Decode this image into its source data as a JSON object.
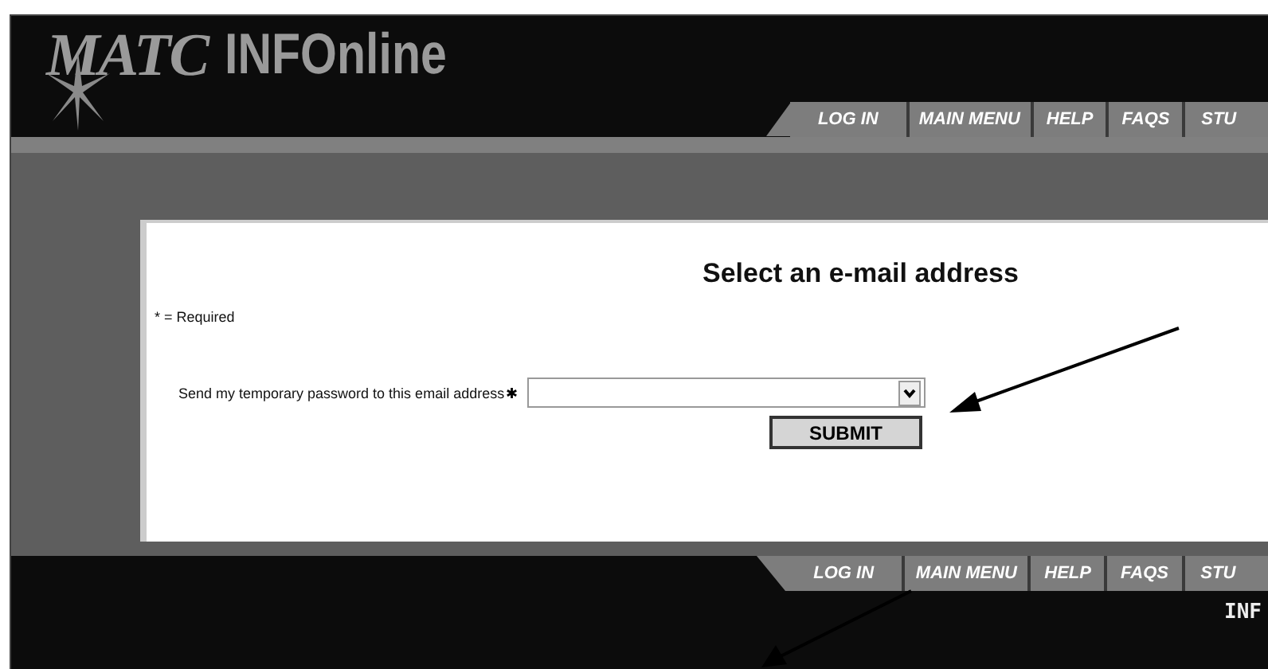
{
  "header": {
    "logo_brand": "MATC",
    "logo_product": "INFOnline"
  },
  "top_nav": [
    {
      "label": "LOG IN"
    },
    {
      "label": "MAIN MENU"
    },
    {
      "label": "HELP"
    },
    {
      "label": "FAQS"
    },
    {
      "label": "STU"
    }
  ],
  "form": {
    "title": "Select an e-mail address",
    "required_note": "* = Required",
    "field_label": "Send my temporary password to this email address",
    "required_mark": "✱",
    "submit": "SUBMIT"
  },
  "bottom_nav": [
    {
      "label": "LOG IN"
    },
    {
      "label": "MAIN MENU"
    },
    {
      "label": "HELP"
    },
    {
      "label": "FAQS"
    },
    {
      "label": "STU"
    }
  ],
  "footer": {
    "text": "INF"
  }
}
